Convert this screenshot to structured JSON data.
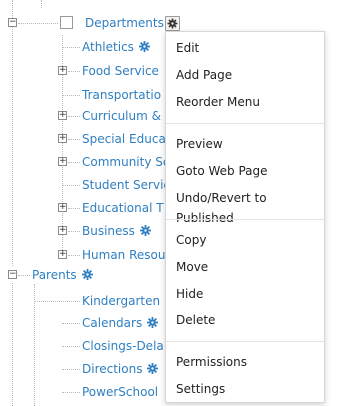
{
  "tree": {
    "departments": "Departments",
    "athletics": "Athletics",
    "food_service": "Food Service",
    "transportation": "Transportatio",
    "curriculum": "Curriculum &",
    "special_education": "Special Educa",
    "community": "Community Sc",
    "student_services": "Student Servic",
    "educational_technology": "Educational T",
    "business": "Business",
    "human_resources": "Human Resou",
    "parents": "Parents",
    "kindergarten": "Kindergarten",
    "calendars": "Calendars",
    "closings": "Closings-Dela",
    "directions": "Directions",
    "powerschool": "PowerSchool"
  },
  "menu": {
    "edit": "Edit",
    "add_page": "Add Page",
    "reorder_menu": "Reorder Menu",
    "preview": "Preview",
    "goto_web_page": "Goto Web Page",
    "undo_revert": "Undo/Revert to Published",
    "copy": "Copy",
    "move": "Move",
    "hide": "Hide",
    "delete": "Delete",
    "permissions": "Permissions",
    "settings": "Settings"
  },
  "colors": {
    "link": "#2f7fc1",
    "gear": "#2f7fc1"
  }
}
